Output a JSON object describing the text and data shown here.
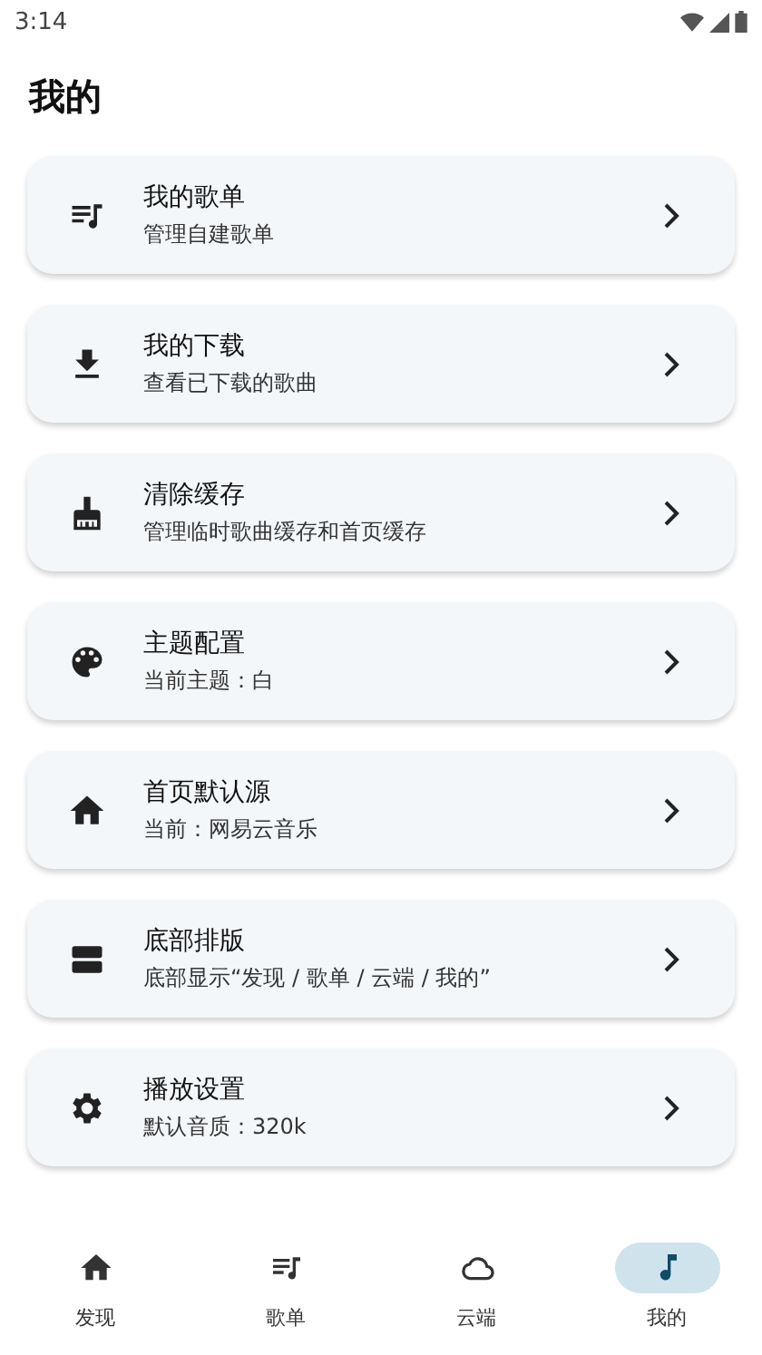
{
  "status_bar": {
    "time": "3:14"
  },
  "title": "我的",
  "items": [
    {
      "kind": "playlist",
      "title": "我的歌单",
      "subtitle": "管理自建歌单"
    },
    {
      "kind": "download",
      "title": "我的下载",
      "subtitle": "查看已下载的歌曲"
    },
    {
      "kind": "broom",
      "title": "清除缓存",
      "subtitle": "管理临时歌曲缓存和首页缓存"
    },
    {
      "kind": "palette",
      "title": "主题配置",
      "subtitle": "当前主题：白"
    },
    {
      "kind": "home",
      "title": "首页默认源",
      "subtitle": "当前：网易云音乐"
    },
    {
      "kind": "layout",
      "title": "底部排版",
      "subtitle": "底部显示“发现 / 歌单 / 云端 / 我的”"
    },
    {
      "kind": "gear",
      "title": "播放设置",
      "subtitle": "默认音质：320k"
    }
  ],
  "nav": [
    {
      "kind": "home",
      "label": "发现",
      "selected": false
    },
    {
      "kind": "playlist",
      "label": "歌单",
      "selected": false
    },
    {
      "kind": "cloud",
      "label": "云端",
      "selected": false
    },
    {
      "kind": "user",
      "label": "我的",
      "selected": true
    }
  ]
}
